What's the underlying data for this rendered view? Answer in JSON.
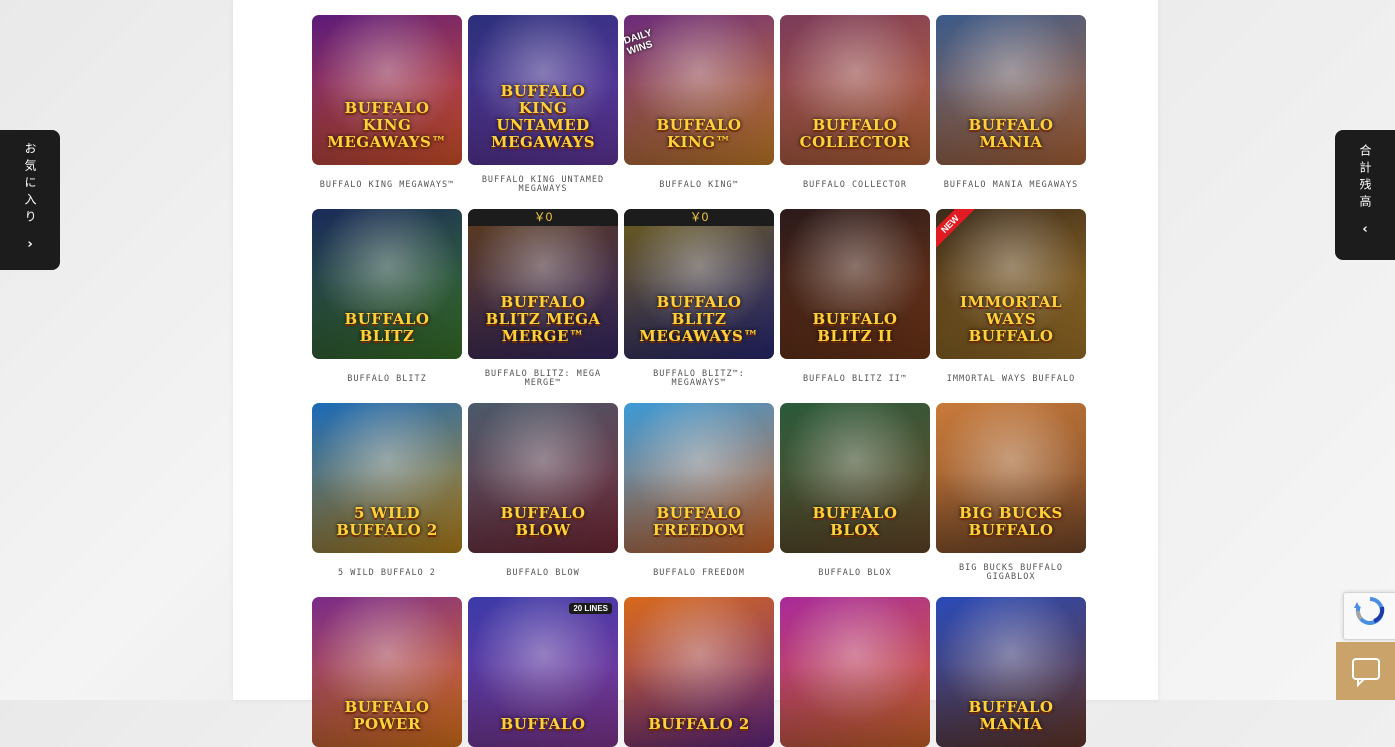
{
  "sidebar_left": {
    "label": "お気に入り",
    "chevron": "›"
  },
  "sidebar_right": {
    "label": "合計残高",
    "chevron": "‹"
  },
  "games": [
    {
      "caption": "BUFFALO KING MEGAWAYS™",
      "art": "BUFFALO KING MEGAWAYS™",
      "c1": "#5a1a7a",
      "c2": "#e2572b"
    },
    {
      "caption": "BUFFALO KING UNTAMED MEGAWAYS",
      "art": "BUFFALO KING UNTAMED MEGAWAYS",
      "c1": "#2b2f7a",
      "c2": "#6a3aa8"
    },
    {
      "caption": "BUFFALO KING™",
      "art": "BUFFALO KING™",
      "c1": "#6a2a7a",
      "c2": "#d1842b",
      "badge": "DAILY WINS"
    },
    {
      "caption": "BUFFALO COLLECTOR",
      "art": "BUFFALO COLLECTOR",
      "c1": "#7a3a5a",
      "c2": "#c26a3a"
    },
    {
      "caption": "BUFFALO MANIA MEGAWAYS",
      "art": "BUFFALO MANIA",
      "c1": "#3a5a8a",
      "c2": "#b86a3a"
    },
    {
      "caption": "BUFFALO BLITZ",
      "art": "BUFFALO BLITZ",
      "c1": "#1a2a5a",
      "c2": "#3c7a2a"
    },
    {
      "caption": "BUFFALO BLITZ: MEGA MERGE™",
      "art": "BUFFALO BLITZ MEGA MERGE™",
      "c1": "#5a3a1a",
      "c2": "#3a2a6a",
      "jackpot": "￥0"
    },
    {
      "caption": "BUFFALO BLITZ™: MEGAWAYS™",
      "art": "BUFFALO BLITZ MEGAWAYS™",
      "c1": "#6a5a1a",
      "c2": "#2a2a7a",
      "jackpot": "￥0"
    },
    {
      "caption": "BUFFALO BLITZ II™",
      "art": "BUFFALO BLITZ II",
      "c1": "#2a1a1a",
      "c2": "#7a3a1a"
    },
    {
      "caption": "IMMORTAL WAYS BUFFALO",
      "art": "IMMORTAL WAYS BUFFALO",
      "c1": "#3a2a1a",
      "c2": "#a87a2a",
      "ribbon": "NEW"
    },
    {
      "caption": "5 WILD BUFFALO 2",
      "art": "5 WILD BUFFALO 2",
      "c1": "#1a6ab8",
      "c2": "#c28a1a"
    },
    {
      "caption": "BUFFALO BLOW",
      "art": "BUFFALO BLOW",
      "c1": "#4a5a6a",
      "c2": "#7a2a3a"
    },
    {
      "caption": "BUFFALO FREEDOM",
      "art": "BUFFALO FREEDOM",
      "c1": "#3a9ad8",
      "c2": "#d86a2a"
    },
    {
      "caption": "BUFFALO BLOX",
      "art": "BUFFALO BLOX",
      "c1": "#2a5a3a",
      "c2": "#6a4a2a"
    },
    {
      "caption": "BIG BUCKS BUFFALO GIGABLOX",
      "art": "BIG BUCKS BUFFALO",
      "c1": "#c87a3a",
      "c2": "#7a4a2a"
    },
    {
      "caption": "",
      "art": "BUFFALO POWER",
      "c1": "#7a2a8a",
      "c2": "#e87a1a"
    },
    {
      "caption": "",
      "art": "BUFFALO",
      "c1": "#3a3aa8",
      "c2": "#8a3a9a",
      "lines": "20 LINES"
    },
    {
      "caption": "",
      "art": "BUFFALO 2",
      "c1": "#d86a1a",
      "c2": "#6a2a8a"
    },
    {
      "caption": "",
      "art": "",
      "c1": "#a82a9a",
      "c2": "#d86a2a"
    },
    {
      "caption": "",
      "art": "BUFFALO MANIA",
      "c1": "#2a4ab8",
      "c2": "#6a3a2a"
    }
  ]
}
